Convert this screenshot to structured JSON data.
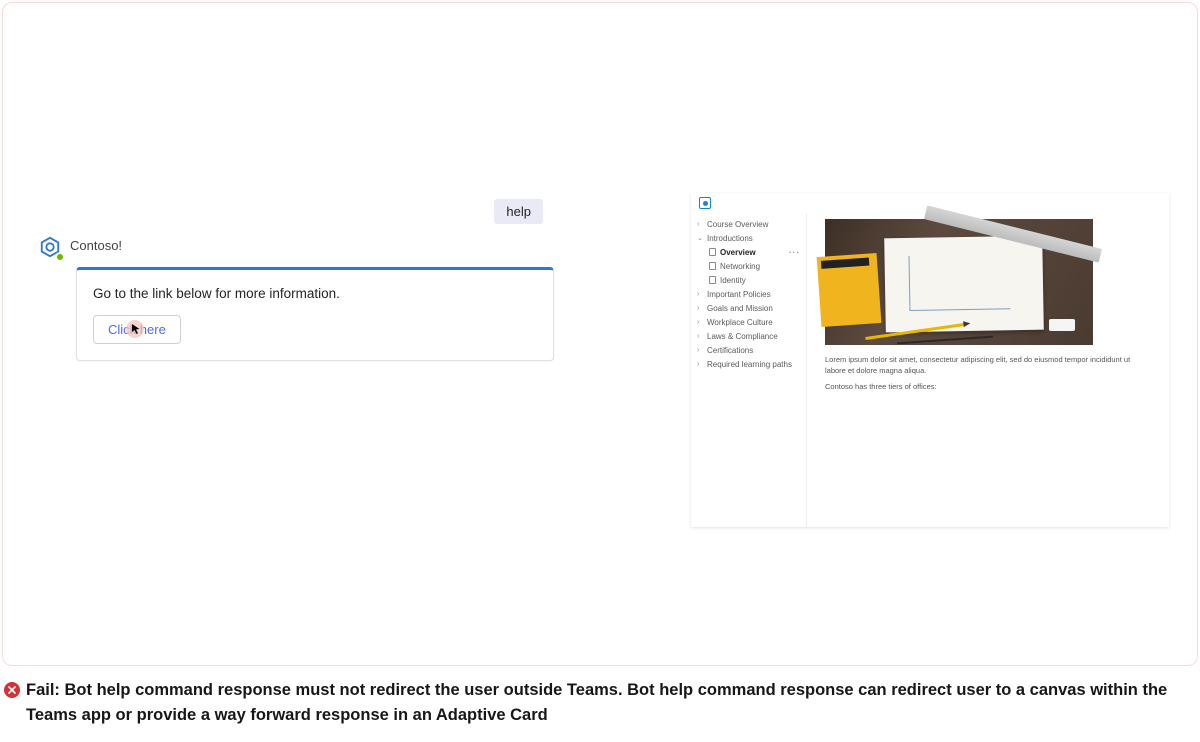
{
  "chat": {
    "user_message": "help",
    "bot_name": "Contoso!",
    "card_text": "Go to the link below for more information.",
    "button_label": "Click here"
  },
  "app": {
    "nav": [
      {
        "label": "Course Overview",
        "type": "chevron"
      },
      {
        "label": "Introductions",
        "type": "chevron-open"
      },
      {
        "label": "Overview",
        "type": "sub-doc",
        "selected": true,
        "more": true
      },
      {
        "label": "Networking",
        "type": "sub-doc"
      },
      {
        "label": "Identity",
        "type": "sub-doc"
      },
      {
        "label": "Important Policies",
        "type": "chevron"
      },
      {
        "label": "Goals and Mission",
        "type": "chevron"
      },
      {
        "label": "Workplace Culture",
        "type": "chevron"
      },
      {
        "label": "Laws & Compliance",
        "type": "chevron"
      },
      {
        "label": "Certifications",
        "type": "chevron"
      },
      {
        "label": "Required learning paths",
        "type": "chevron"
      }
    ],
    "paragraph": "Lorem ipsum dolor sit amet, consectetur adipiscing elit, sed do eiusmod tempor incididunt ut labore et dolore magna aliqua.",
    "line2": "Contoso has three tiers of offices:"
  },
  "caption": {
    "text": "Fail: Bot help command response must not redirect the user outside Teams. Bot help command response can redirect user to a canvas within the Teams app or provide a way forward response in an Adaptive Card"
  }
}
